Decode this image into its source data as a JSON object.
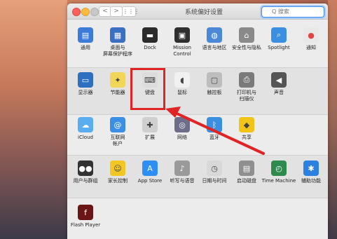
{
  "window": {
    "title": "系统偏好设置",
    "search": {
      "value": "",
      "placeholder": "Q 搜索"
    },
    "nav": {
      "back": "<",
      "forward": ">",
      "grid": "⋮⋮⋮"
    }
  },
  "rows": [
    {
      "items": [
        {
          "label": "通用",
          "icon": "general-icon",
          "color": "#3d7bd9"
        },
        {
          "label": "桌面与\n屏幕保护程序",
          "icon": "desktop-icon",
          "color": "#3a6fc2"
        },
        {
          "label": "Dock",
          "icon": "dock-icon",
          "color": "#2b2b2b"
        },
        {
          "label": "Mission\nControl",
          "icon": "mission-control-icon",
          "color": "#2f2f2f"
        },
        {
          "label": "语言与地区",
          "icon": "globe-icon",
          "color": "#4b88d6"
        },
        {
          "label": "安全性与隐私",
          "icon": "lock-house-icon",
          "color": "#8a8a8a"
        },
        {
          "label": "Spotlight",
          "icon": "spotlight-icon",
          "color": "#3b8fe0"
        },
        {
          "label": "通知",
          "icon": "notifications-icon",
          "color": "#e8e8e8"
        }
      ]
    },
    {
      "items": [
        {
          "label": "显示器",
          "icon": "display-icon",
          "color": "#2e6fbf"
        },
        {
          "label": "节能器",
          "icon": "bulb-icon",
          "color": "#f2d65a"
        },
        {
          "label": "键盘",
          "icon": "keyboard-icon",
          "color": "#dcdcdc"
        },
        {
          "label": "鼠标",
          "icon": "mouse-icon",
          "color": "#f1f1f1"
        },
        {
          "label": "触控板",
          "icon": "trackpad-icon",
          "color": "#bdbdbd"
        },
        {
          "label": "打印机与\n扫描仪",
          "icon": "printer-icon",
          "color": "#7a7a7a"
        },
        {
          "label": "声音",
          "icon": "speaker-icon",
          "color": "#555555"
        }
      ]
    },
    {
      "items": [
        {
          "label": "iCloud",
          "icon": "icloud-icon",
          "color": "#5aaef0"
        },
        {
          "label": "互联网\n帐户",
          "icon": "at-icon",
          "color": "#3a8ee6"
        },
        {
          "label": "扩展",
          "icon": "puzzle-icon",
          "color": "#cfcfcf"
        },
        {
          "label": "网络",
          "icon": "network-globe-icon",
          "color": "#6d6d8a"
        },
        {
          "label": "蓝牙",
          "icon": "bluetooth-icon",
          "color": "#3b8fe0"
        },
        {
          "label": "共享",
          "icon": "sharing-icon",
          "color": "#f0c419"
        }
      ]
    },
    {
      "items": [
        {
          "label": "用户与群组",
          "icon": "users-icon",
          "color": "#333333"
        },
        {
          "label": "家长控制",
          "icon": "parental-icon",
          "color": "#f3c623"
        },
        {
          "label": "App Store",
          "icon": "appstore-icon",
          "color": "#2f8ef5"
        },
        {
          "label": "听写与语音",
          "icon": "microphone-icon",
          "color": "#9a9a9a"
        },
        {
          "label": "日期与时间",
          "icon": "clock-calendar-icon",
          "color": "#d8d8d8"
        },
        {
          "label": "启动磁盘",
          "icon": "disk-icon",
          "color": "#8f8f8f"
        },
        {
          "label": "Time Machine",
          "icon": "time-machine-icon",
          "color": "#2f8a4e"
        },
        {
          "label": "辅助功能",
          "icon": "accessibility-icon",
          "color": "#2c80e0"
        }
      ]
    },
    {
      "items": [
        {
          "label": "Flash Player",
          "icon": "flash-icon",
          "color": "#6b1616"
        }
      ]
    }
  ],
  "annotation": {
    "highlight_color": "#e02424"
  }
}
